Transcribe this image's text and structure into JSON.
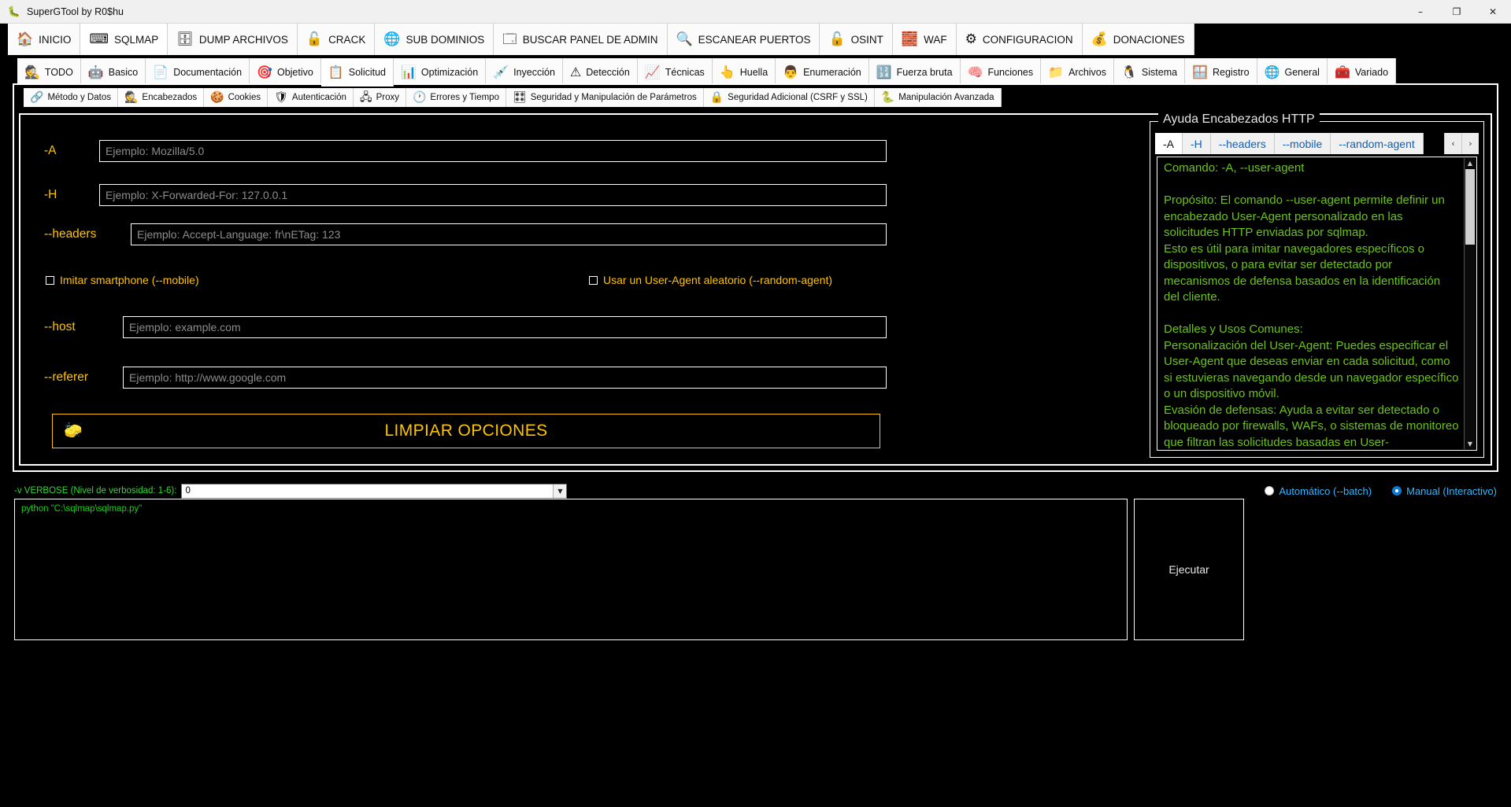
{
  "window": {
    "title": "SuperGTool by R0$hu",
    "app_icon": "bug-icon",
    "minimize": "–",
    "maximize": "❐",
    "close": "✕"
  },
  "ribbon_primary": {
    "tabs": [
      {
        "label": "INICIO",
        "icon": "home-icon",
        "glyph": "🏠",
        "selected": false
      },
      {
        "label": "SQLMAP",
        "icon": "terminal-icon",
        "glyph": "⌨",
        "selected": true
      },
      {
        "label": "DUMP ARCHIVOS",
        "icon": "database-download-icon",
        "glyph": "🗄",
        "selected": false
      },
      {
        "label": "CRACK",
        "icon": "unlock-icon",
        "glyph": "🔓",
        "selected": false
      },
      {
        "label": "SUB DOMINIOS",
        "icon": "globe-network-icon",
        "glyph": "🌐",
        "selected": false
      },
      {
        "label": "BUSCAR PANEL DE ADMIN",
        "icon": "admin-panel-icon",
        "glyph": "🗔",
        "selected": false
      },
      {
        "label": "ESCANEAR PUERTOS",
        "icon": "port-scan-icon",
        "glyph": "🔍",
        "selected": false
      },
      {
        "label": "OSINT",
        "icon": "padlock-data-icon",
        "glyph": "🔓",
        "selected": false
      },
      {
        "label": "WAF",
        "icon": "firewall-brick-icon",
        "glyph": "🧱",
        "selected": false
      },
      {
        "label": "CONFIGURACION",
        "icon": "gear-icon",
        "glyph": "⚙",
        "selected": false
      },
      {
        "label": "DONACIONES",
        "icon": "donate-box-icon",
        "glyph": "💰",
        "selected": false
      }
    ]
  },
  "ribbon_secondary": {
    "tabs": [
      {
        "label": "TODO",
        "icon": "hacker-icon",
        "glyph": "🕵",
        "selected": false
      },
      {
        "label": "Basico",
        "icon": "robot-icon",
        "glyph": "🤖",
        "selected": false
      },
      {
        "label": "Documentación",
        "icon": "sql-document-icon",
        "glyph": "📄",
        "selected": false
      },
      {
        "label": "Objetivo",
        "icon": "target-icon",
        "glyph": "🎯",
        "selected": false
      },
      {
        "label": "Solicitud",
        "icon": "request-form-icon",
        "glyph": "📋",
        "selected": true
      },
      {
        "label": "Optimización",
        "icon": "speed-gauge-icon",
        "glyph": "📊",
        "selected": false
      },
      {
        "label": "Inyección",
        "icon": "injection-icon",
        "glyph": "💉",
        "selected": false
      },
      {
        "label": "Detección",
        "icon": "detection-meter-icon",
        "glyph": "⚠",
        "selected": false
      },
      {
        "label": "Técnicas",
        "icon": "pie-chart-icon",
        "glyph": "📈",
        "selected": false
      },
      {
        "label": "Huella",
        "icon": "fingerprint-icon",
        "glyph": "👆",
        "selected": false
      },
      {
        "label": "Enumeración",
        "icon": "enumeration-icon",
        "glyph": "👨",
        "selected": false
      },
      {
        "label": "Fuerza bruta",
        "icon": "binary-code-icon",
        "glyph": "🔢",
        "selected": false
      },
      {
        "label": "Funciones",
        "icon": "brain-icon",
        "glyph": "🧠",
        "selected": false
      },
      {
        "label": "Archivos",
        "icon": "root-file-icon",
        "glyph": "📁",
        "selected": false
      },
      {
        "label": "Sistema",
        "icon": "linux-penguin-icon",
        "glyph": "🐧",
        "selected": false
      },
      {
        "label": "Registro",
        "icon": "windows-icon",
        "glyph": "🪟",
        "selected": false
      },
      {
        "label": "General",
        "icon": "globe-gear-icon",
        "glyph": "🌐",
        "selected": false
      },
      {
        "label": "Variado",
        "icon": "toolbox-icon",
        "glyph": "🧰",
        "selected": false
      }
    ]
  },
  "ribbon_tertiary": {
    "tabs": [
      {
        "label": "Método y Datos",
        "icon": "method-data-icon",
        "glyph": "🔗",
        "selected": false
      },
      {
        "label": "Encabezados",
        "icon": "spy-hat-icon",
        "glyph": "🕵",
        "selected": true
      },
      {
        "label": "Cookies",
        "icon": "cookie-icon",
        "glyph": "🍪",
        "selected": false
      },
      {
        "label": "Autenticación",
        "icon": "shield-check-icon",
        "glyph": "🛡",
        "selected": false
      },
      {
        "label": "Proxy",
        "icon": "proxy-server-icon",
        "glyph": "🖧",
        "selected": false
      },
      {
        "label": "Errores y Tiempo",
        "icon": "clock-error-icon",
        "glyph": "🕐",
        "selected": false
      },
      {
        "label": "Seguridad y Manipulación de Parámetros",
        "icon": "sliders-icon",
        "glyph": "🎛",
        "selected": false
      },
      {
        "label": "Seguridad Adicional (CSRF y SSL)",
        "icon": "ssl-shield-icon",
        "glyph": "🔒",
        "selected": false
      },
      {
        "label": "Manipulación Avanzada",
        "icon": "python-icon",
        "glyph": "🐍",
        "selected": false
      }
    ]
  },
  "form": {
    "fields": [
      {
        "label": "-A",
        "name": "user-agent-input",
        "value": "",
        "placeholder": "Ejemplo: Mozilla/5.0"
      },
      {
        "label": "-H",
        "name": "header-input",
        "value": "",
        "placeholder": "Ejemplo: X-Forwarded-For: 127.0.0.1"
      },
      {
        "label": "--headers",
        "name": "headers-input",
        "value": "",
        "placeholder": "Ejemplo: Accept-Language: fr\\nETag: 123"
      },
      {
        "label": "--host",
        "name": "host-input",
        "value": "",
        "placeholder": "Ejemplo: example.com"
      },
      {
        "label": "--referer",
        "name": "referer-input",
        "value": "",
        "placeholder": "Ejemplo: http://www.google.com"
      }
    ],
    "checkboxes": [
      {
        "label": "Imitar smartphone (--mobile)",
        "name": "mobile-checkbox",
        "checked": false
      },
      {
        "label": "Usar un User-Agent aleatorio (--random-agent)",
        "name": "random-agent-checkbox",
        "checked": false
      }
    ],
    "clear_button": {
      "label": "LIMPIAR OPCIONES",
      "icon": "eraser-icon",
      "glyph": "🧽"
    }
  },
  "help": {
    "legend": "Ayuda Encabezados HTTP",
    "tabs": [
      {
        "label": "-A",
        "selected": true
      },
      {
        "label": "-H",
        "selected": false
      },
      {
        "label": "--headers",
        "selected": false
      },
      {
        "label": "--mobile",
        "selected": false
      },
      {
        "label": "--random-agent",
        "selected": false
      }
    ],
    "prev_arrow": "‹",
    "next_arrow": "›",
    "body": "Comando: -A, --user-agent\n\nPropósito: El comando --user-agent permite definir un encabezado User-Agent personalizado en las solicitudes HTTP enviadas por sqlmap.\nEsto es útil para imitar navegadores específicos o dispositivos, o para evitar ser detectado por mecanismos de defensa basados en la identificación del cliente.\n\nDetalles y Usos Comunes:\nPersonalización del User-Agent: Puedes especificar el User-Agent que deseas enviar en cada solicitud, como si estuvieras navegando desde un navegador específico o un dispositivo móvil.\nEvasión de defensas: Ayuda a evitar ser detectado o bloqueado por firewalls, WAFs, o sistemas de monitoreo que filtran las solicitudes basadas en User-"
  },
  "bottom": {
    "verbose_label": "-v VERBOSE (Nivel de verbosidad: 1-6):",
    "verbose_value": "0",
    "verbose_caret": "▼",
    "modes": [
      {
        "label": "Automático (--batch)",
        "name": "mode-automatic-radio",
        "selected": false
      },
      {
        "label": "Manual (Interactivo)",
        "name": "mode-manual-radio",
        "selected": true
      }
    ],
    "console_command": "python \"C:\\sqlmap\\sqlmap.py\"",
    "execute_label": "Ejecutar"
  },
  "colors": {
    "accent_yellow": "#ffc400",
    "help_green": "#6cc318",
    "console_green": "#13d413",
    "radio_blue": "#35b7ff",
    "verbose_green": "#2fdc2f"
  }
}
